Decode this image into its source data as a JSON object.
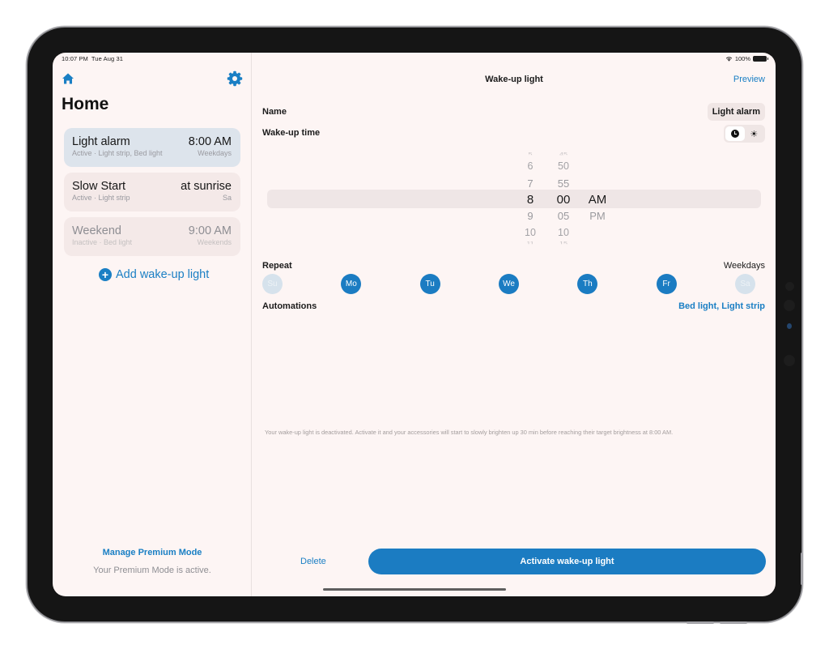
{
  "status_bar": {
    "time": "10:07 PM",
    "date": "Tue Aug 31",
    "battery": "100%"
  },
  "sidebar": {
    "title": "Home",
    "alarms": [
      {
        "name": "Light alarm",
        "time": "8:00 AM",
        "detail": "Active · Light strip, Bed light",
        "days": "Weekdays",
        "selected": true,
        "active": true
      },
      {
        "name": "Slow Start",
        "time": "at sunrise",
        "detail": "Active · Light strip",
        "days": "Sa",
        "selected": false,
        "active": true
      },
      {
        "name": "Weekend",
        "time": "9:00 AM",
        "detail": "Inactive · Bed light",
        "days": "Weekends",
        "selected": false,
        "active": false
      }
    ],
    "add_label": "Add wake-up light",
    "premium_link": "Manage Premium Mode",
    "premium_status": "Your Premium Mode is active."
  },
  "detail": {
    "title": "Wake-up light",
    "preview_label": "Preview",
    "name_label": "Name",
    "name_value": "Light alarm",
    "time_label": "Wake-up time",
    "time_modes": [
      "clock",
      "sunrise"
    ],
    "time_mode_selected": "clock",
    "picker": {
      "hours": [
        "5",
        "6",
        "7",
        "8",
        "9",
        "10",
        "11"
      ],
      "minutes": [
        "45",
        "50",
        "55",
        "00",
        "05",
        "10",
        "15"
      ],
      "periods": [
        "AM",
        "PM"
      ],
      "selected": {
        "hour": "8",
        "minute": "00",
        "period": "AM"
      }
    },
    "repeat_label": "Repeat",
    "repeat_value": "Weekdays",
    "days": [
      {
        "label": "Su",
        "on": false
      },
      {
        "label": "Mo",
        "on": true
      },
      {
        "label": "Tu",
        "on": true
      },
      {
        "label": "We",
        "on": true
      },
      {
        "label": "Th",
        "on": true
      },
      {
        "label": "Fr",
        "on": true
      },
      {
        "label": "Sa",
        "on": false
      }
    ],
    "automations_label": "Automations",
    "automations_value": "Bed light, Light strip",
    "footnote": "Your wake-up light is deactivated. Activate it and your accessories will start to slowly brighten up 30 min before reaching their target brightness at 8:00 AM.",
    "delete_label": "Delete",
    "activate_label": "Activate wake-up light"
  },
  "colors": {
    "accent": "#1b7cc2",
    "background": "#fdf5f4",
    "selected_card": "#dde4ec"
  }
}
